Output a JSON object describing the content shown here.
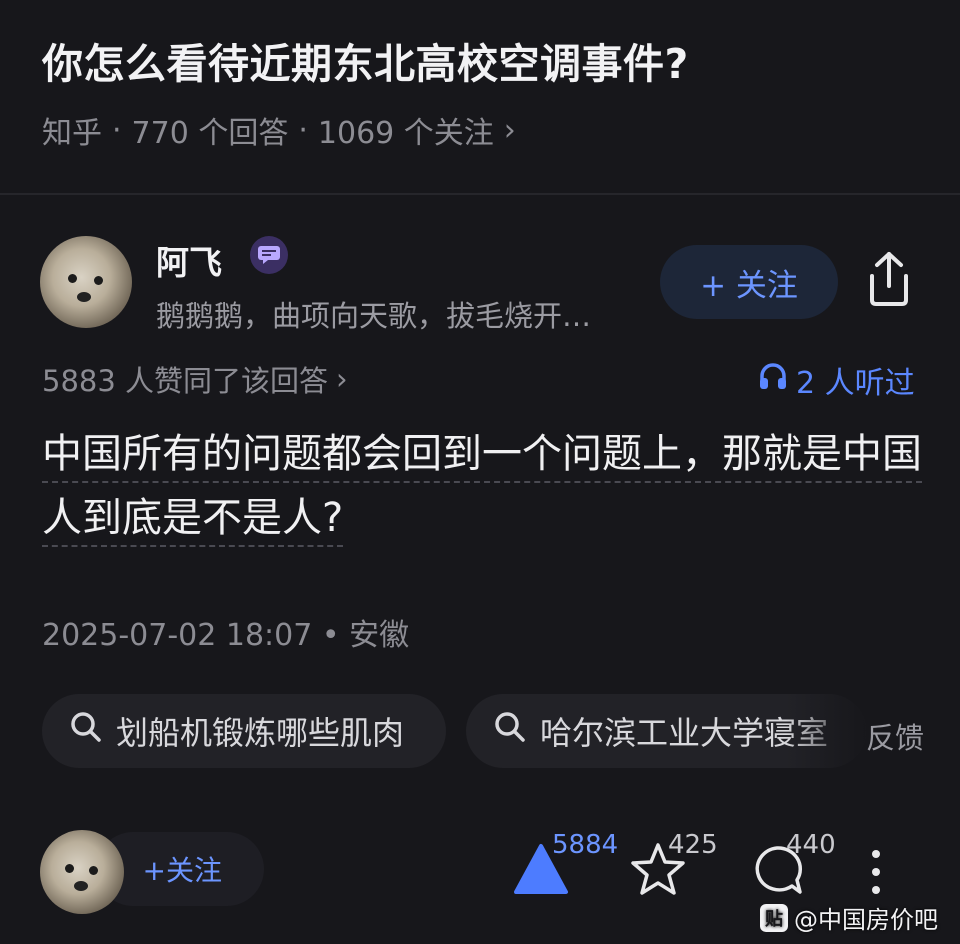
{
  "question": {
    "title": "你怎么看待近期东北高校空调事件?",
    "source": "知乎",
    "answer_count": "770 个回答",
    "follow_count": "1069 个关注",
    "separator": "·",
    "chevron": "›"
  },
  "author": {
    "name": "阿飞",
    "bio": "鹅鹅鹅，曲项向天歌，拔毛烧开…",
    "badge_icon": "chat-badge-icon",
    "follow_label": "+ 关注"
  },
  "answer": {
    "likes_text": "5883 人赞同了该回答",
    "listen_text": "2 人听过",
    "content": "中国所有的问题都会回到一个问题上，那就是中国人到底是不是人?",
    "date_location": "2025-07-02 18:07 • 安徽"
  },
  "related_searches": [
    {
      "label": "划船机锻炼哪些肌肉"
    },
    {
      "label": "哈尔滨工业大学寝室"
    }
  ],
  "feedback_label": "反馈",
  "bottom_bar": {
    "follow_label": "+关注",
    "upvote_count": "5884",
    "star_count": "425",
    "comment_count": "440"
  },
  "watermark": {
    "logo_glyph": "贴",
    "text": "@中国房价吧"
  },
  "colors": {
    "background": "#17171b",
    "accent": "#6c95ff",
    "upvote": "#4d7cff",
    "muted": "#8c8c93"
  }
}
